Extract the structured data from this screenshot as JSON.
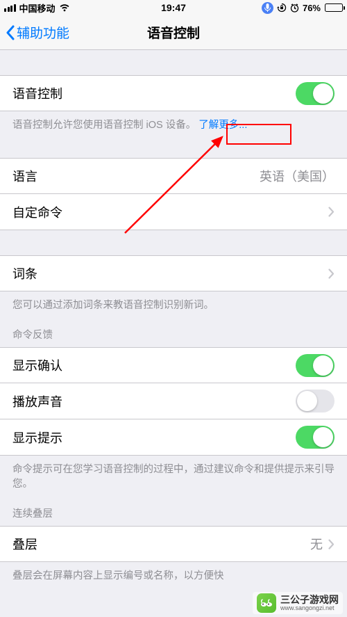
{
  "status": {
    "carrier": "中国移动",
    "time": "19:47",
    "battery_pct": "76%"
  },
  "nav": {
    "back_label": "辅助功能",
    "title": "语音控制"
  },
  "main_toggle": {
    "label": "语音控制",
    "on": true
  },
  "main_footer": {
    "text": "语音控制允许您使用语音控制 iOS 设备。",
    "link": "了解更多..."
  },
  "lang_row": {
    "label": "语言",
    "value": "英语（美国）"
  },
  "custom_cmds": {
    "label": "自定命令"
  },
  "vocab_row": {
    "label": "词条"
  },
  "vocab_footer": "您可以通过添加词条来教语音控制识别新词。",
  "feedback_header": "命令反馈",
  "show_confirm": {
    "label": "显示确认",
    "on": true
  },
  "play_sound": {
    "label": "播放声音",
    "on": false
  },
  "show_hints": {
    "label": "显示提示",
    "on": true
  },
  "feedback_footer": "命令提示可在您学习语音控制的过程中，通过建议命令和提供提示来引导您。",
  "overlay_header": "连续叠层",
  "overlay_row": {
    "label": "叠层",
    "value": "无"
  },
  "overlay_footer": "叠层会在屏幕内容上显示编号或名称，以方便快",
  "colors": {
    "tint": "#007aff",
    "toggle_on": "#4cd964",
    "annotation": "#ff0000"
  },
  "watermark": {
    "name_cn": "三公子游戏网",
    "name_en": "www.sangongzi.net"
  }
}
